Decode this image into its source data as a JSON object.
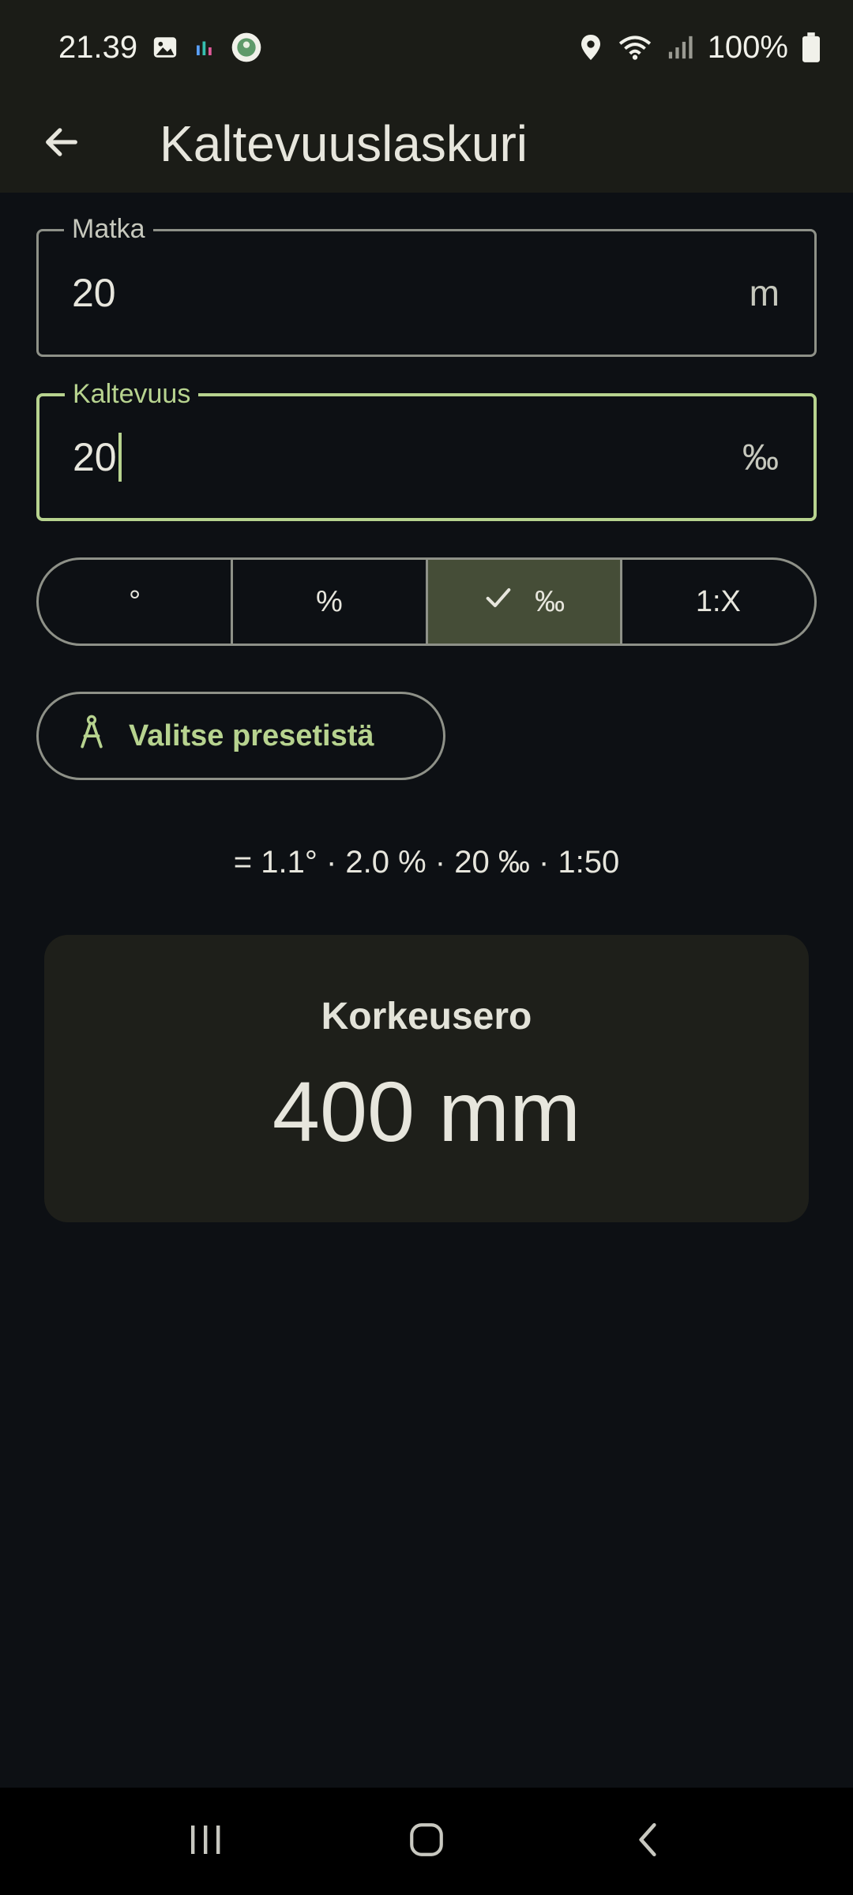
{
  "status_bar": {
    "time": "21.39",
    "battery": "100%",
    "icons": [
      "gallery-icon",
      "equalizer-icon",
      "app-badge-icon",
      "location-icon",
      "wifi-icon",
      "signal-icon",
      "battery-icon"
    ]
  },
  "app_bar": {
    "title": "Kaltevuuslaskuri",
    "back_icon": "arrow-back-icon"
  },
  "distance_field": {
    "label": "Matka",
    "value": "20",
    "suffix": "m"
  },
  "slope_field": {
    "label": "Kaltevuus",
    "value": "20",
    "suffix": "‰"
  },
  "unit_selector": {
    "options": [
      "°",
      "%",
      "‰",
      "1:X"
    ],
    "selected": "‰"
  },
  "preset_button": {
    "label": "Valitse presetistä",
    "icon": "compass-icon"
  },
  "conversions": "= 1.1° · 2.0 % · 20 ‰ · 1:50",
  "result": {
    "label": "Korkeusero",
    "value": "400 mm"
  },
  "nav_bar": {
    "icons": [
      "recent-apps-icon",
      "home-icon",
      "back-icon"
    ]
  },
  "colors": {
    "accent": "#b7d38f",
    "background": "#0d1014",
    "surface": "#1b1c17",
    "selected_segment": "#454d37"
  }
}
